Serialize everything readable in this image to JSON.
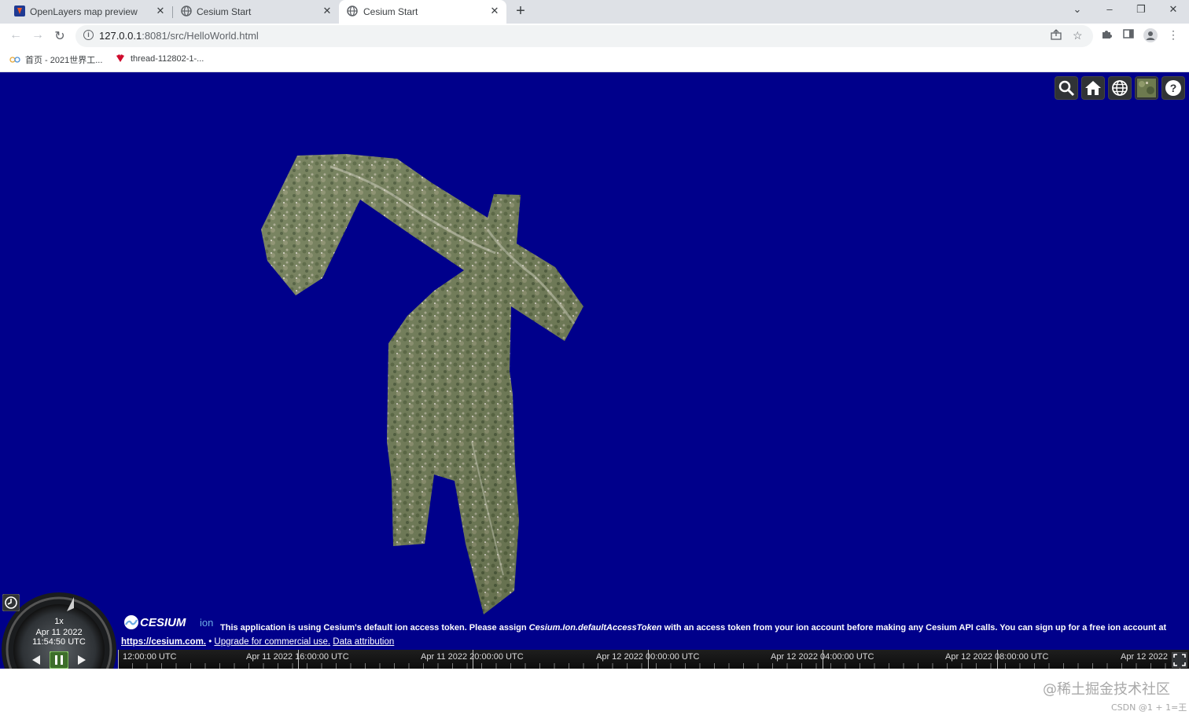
{
  "browser": {
    "tabs": [
      {
        "title": "OpenLayers map preview",
        "favicon": "openlayers-icon",
        "active": false
      },
      {
        "title": "Cesium Start",
        "favicon": "globe-icon",
        "active": false
      },
      {
        "title": "Cesium Start",
        "favicon": "globe-icon",
        "active": true
      }
    ],
    "new_tab": "+",
    "window_controls": {
      "tab_search": "⌄",
      "minimize": "–",
      "restore": "❐",
      "close": "✕"
    },
    "address_host": "127.0.0.1",
    "address_rest": ":8081/src/HelloWorld.html",
    "nav": {
      "back": "←",
      "forward": "→",
      "reload": "↻"
    },
    "bookmarks": [
      {
        "label": "首页 - 2021世界工...",
        "icon": "folder-icon"
      },
      {
        "label": "thread-112802-1-...",
        "icon": "huawei-icon"
      }
    ]
  },
  "cesium": {
    "toolbar_buttons": [
      {
        "name": "geocoder-search",
        "icon": "search-icon"
      },
      {
        "name": "home",
        "icon": "home-icon"
      },
      {
        "name": "scene-mode",
        "icon": "globe-icon"
      },
      {
        "name": "base-layer-picker",
        "icon": "imagery-icon"
      },
      {
        "name": "navigation-help",
        "icon": "help-icon"
      }
    ],
    "animation": {
      "speed": "1x",
      "date": "Apr 11 2022",
      "time": "11:54:50 UTC"
    },
    "credits": {
      "logo_text": "CESIUM",
      "logo_suffix": "ion",
      "message_before": "This application is using Cesium's default ion access token. Please assign ",
      "message_code": "Cesium.Ion.defaultAccessToken",
      "message_after": " with an access token from your ion account before making any Cesium API calls. You can sign up for a free ion account at",
      "link_url": "https://cesium.com.",
      "separator": " • ",
      "link_upgrade": "Upgrade for commercial use.",
      "link_attribution": "Data attribution"
    },
    "timeline": {
      "labels": [
        "12:00:00 UTC",
        "Apr 11 2022 16:00:00 UTC",
        "Apr 11 2022 20:00:00 UTC",
        "Apr 12 2022 00:00:00 UTC",
        "Apr 12 2022 04:00:00 UTC",
        "Apr 12 2022 08:00:00 UTC",
        "Apr 12 2022"
      ]
    },
    "globe_color": "#00008b"
  },
  "watermark": {
    "line1": "@稀土掘金技术社区",
    "line2": "CSDN @1 + 1=王"
  }
}
